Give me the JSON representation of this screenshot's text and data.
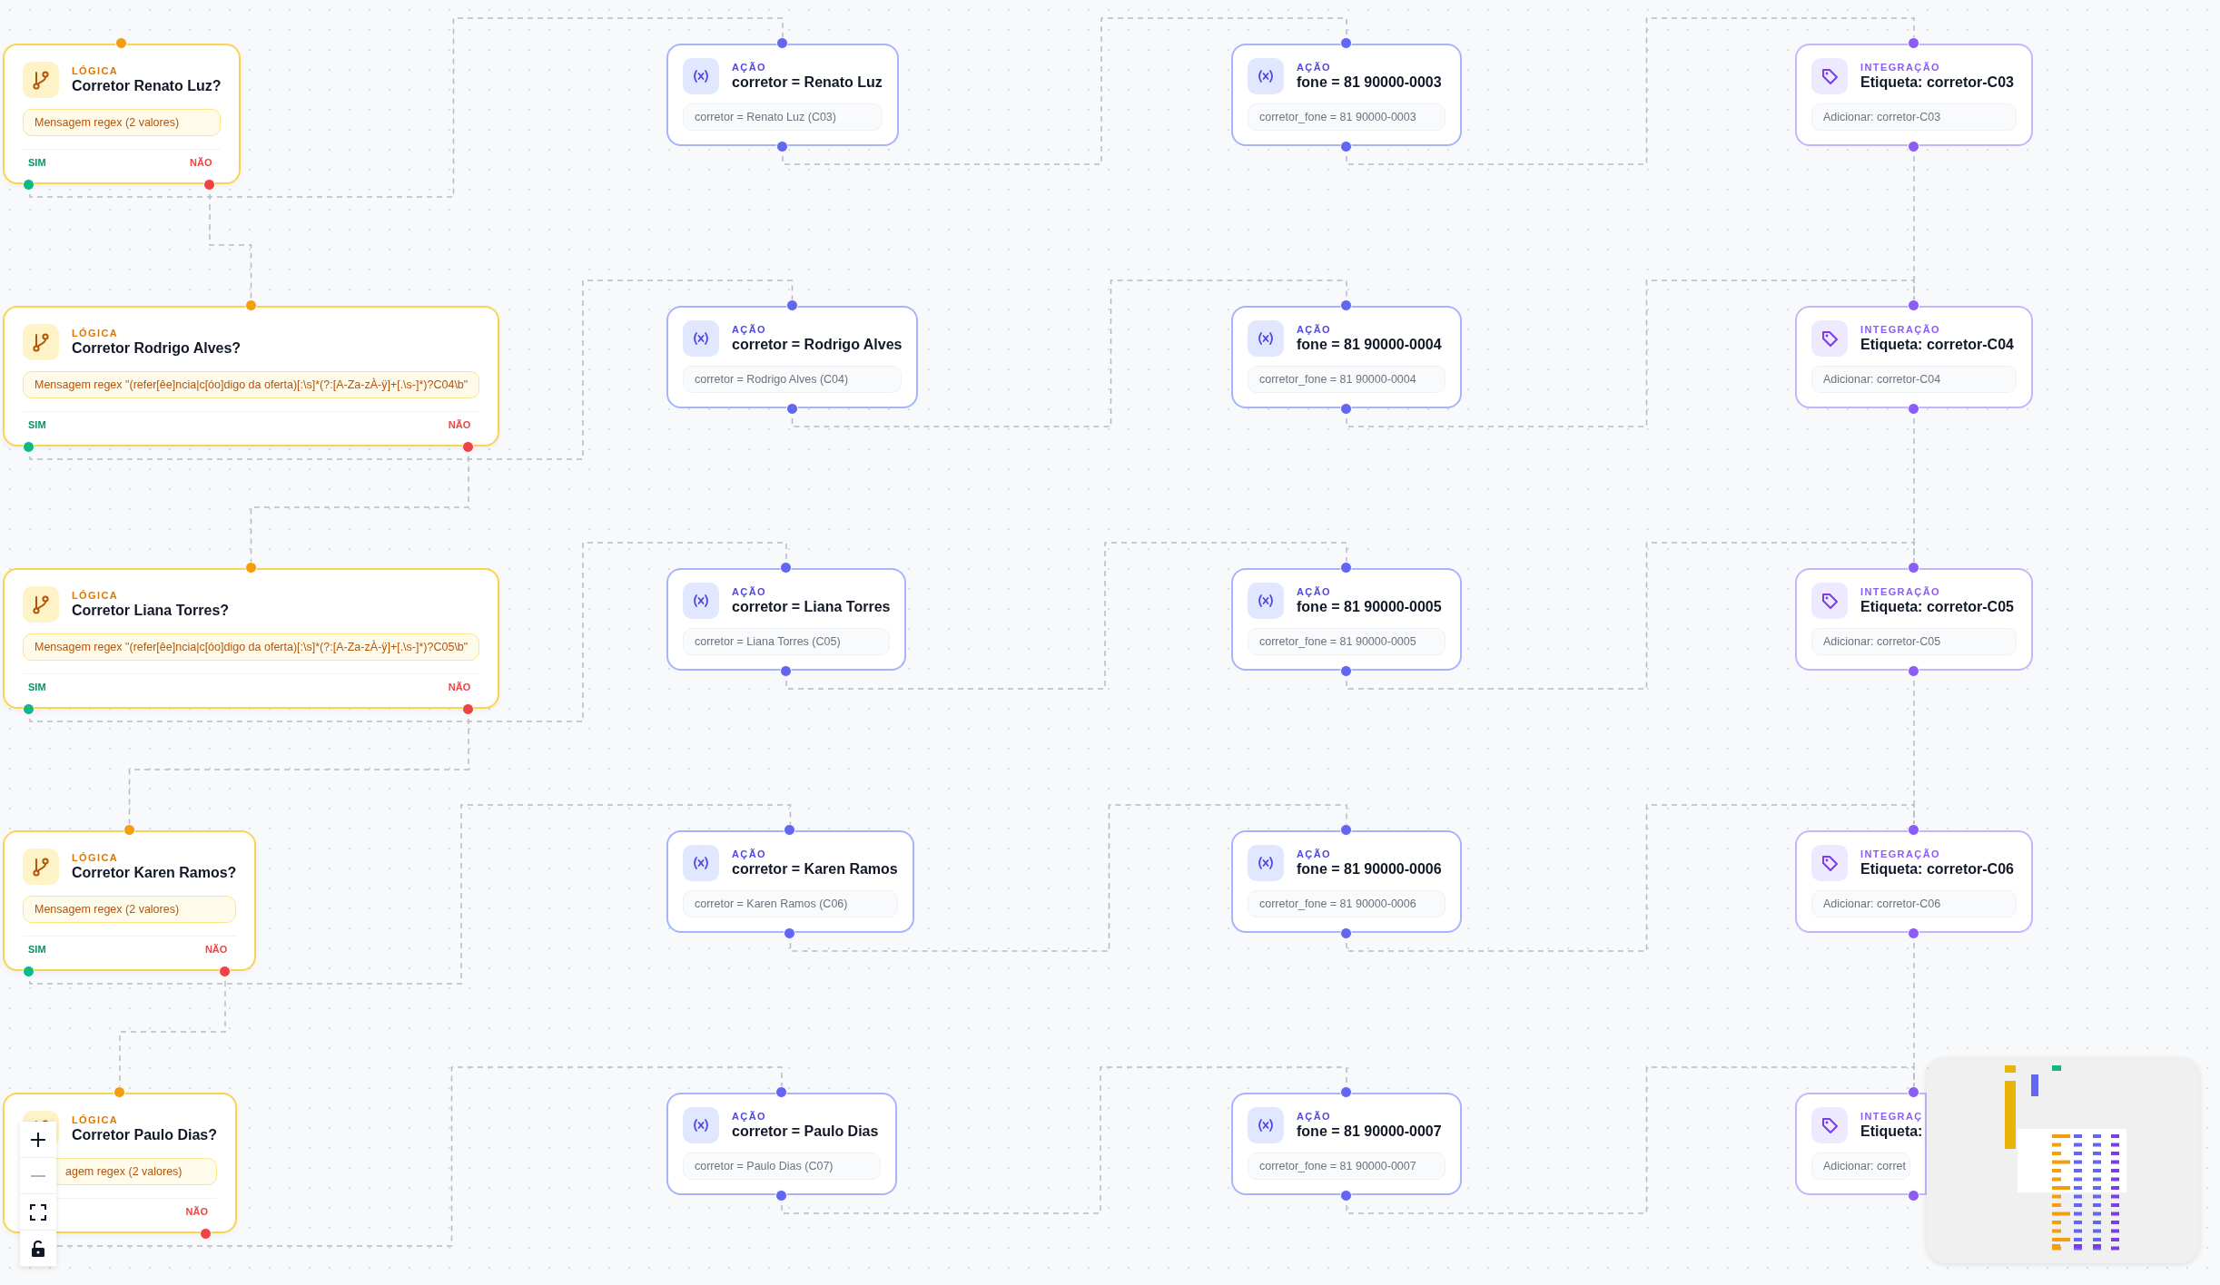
{
  "rows": [
    {
      "logic": {
        "category": "LÓGICA",
        "title": "Corretor Renato Luz?",
        "condition": "Mensagem regex (2 valores)",
        "yes_label": "SIM",
        "no_label": "NÃO"
      },
      "action": {
        "category": "AÇÃO",
        "title": "corretor = Renato Luz",
        "detail": "corretor = Renato Luz (C03)"
      },
      "phone": {
        "category": "AÇÃO",
        "title": "fone = 81 90000-0003",
        "detail": "corretor_fone = 81 90000-0003"
      },
      "tag": {
        "category": "INTEGRAÇÃO",
        "title": "Etiqueta: corretor-C03",
        "detail": "Adicionar: corretor-C03"
      }
    },
    {
      "logic": {
        "category": "LÓGICA",
        "title": "Corretor Rodrigo Alves?",
        "condition": "Mensagem regex \"(refer[êe]ncia|c[óo]digo da oferta)[:\\s]*(?:[A-Za-zÀ-ÿ]+[.\\s-]*)?C04\\b\"",
        "yes_label": "SIM",
        "no_label": "NÃO"
      },
      "action": {
        "category": "AÇÃO",
        "title": "corretor = Rodrigo Alves",
        "detail": "corretor = Rodrigo Alves (C04)"
      },
      "phone": {
        "category": "AÇÃO",
        "title": "fone = 81 90000-0004",
        "detail": "corretor_fone = 81 90000-0004"
      },
      "tag": {
        "category": "INTEGRAÇÃO",
        "title": "Etiqueta: corretor-C04",
        "detail": "Adicionar: corretor-C04"
      }
    },
    {
      "logic": {
        "category": "LÓGICA",
        "title": "Corretor Liana Torres?",
        "condition": "Mensagem regex \"(refer[êe]ncia|c[óo]digo da oferta)[:\\s]*(?:[A-Za-zÀ-ÿ]+[.\\s-]*)?C05\\b\"",
        "yes_label": "SIM",
        "no_label": "NÃO"
      },
      "action": {
        "category": "AÇÃO",
        "title": "corretor = Liana Torres",
        "detail": "corretor = Liana Torres (C05)"
      },
      "phone": {
        "category": "AÇÃO",
        "title": "fone = 81 90000-0005",
        "detail": "corretor_fone = 81 90000-0005"
      },
      "tag": {
        "category": "INTEGRAÇÃO",
        "title": "Etiqueta: corretor-C05",
        "detail": "Adicionar: corretor-C05"
      }
    },
    {
      "logic": {
        "category": "LÓGICA",
        "title": "Corretor Karen Ramos?",
        "condition": "Mensagem regex (2 valores)",
        "yes_label": "SIM",
        "no_label": "NÃO"
      },
      "action": {
        "category": "AÇÃO",
        "title": "corretor = Karen Ramos",
        "detail": "corretor = Karen Ramos (C06)"
      },
      "phone": {
        "category": "AÇÃO",
        "title": "fone = 81 90000-0006",
        "detail": "corretor_fone = 81 90000-0006"
      },
      "tag": {
        "category": "INTEGRAÇÃO",
        "title": "Etiqueta: corretor-C06",
        "detail": "Adicionar: corretor-C06"
      }
    },
    {
      "logic": {
        "category": "LÓGICA",
        "title": "Corretor Paulo Dias?",
        "condition": "agem regex (2 valores)",
        "no_label": "NÃO"
      },
      "action": {
        "category": "AÇÃO",
        "title": "corretor = Paulo Dias",
        "detail": "corretor = Paulo Dias (C07)"
      },
      "phone": {
        "category": "AÇÃO",
        "title": "fone = 81 90000-0007",
        "detail": "corretor_fone = 81 90000-0007"
      },
      "tag": {
        "category": "INTEGRAÇ",
        "title": "Etiqueta:",
        "detail": "Adicionar: corret"
      }
    }
  ]
}
